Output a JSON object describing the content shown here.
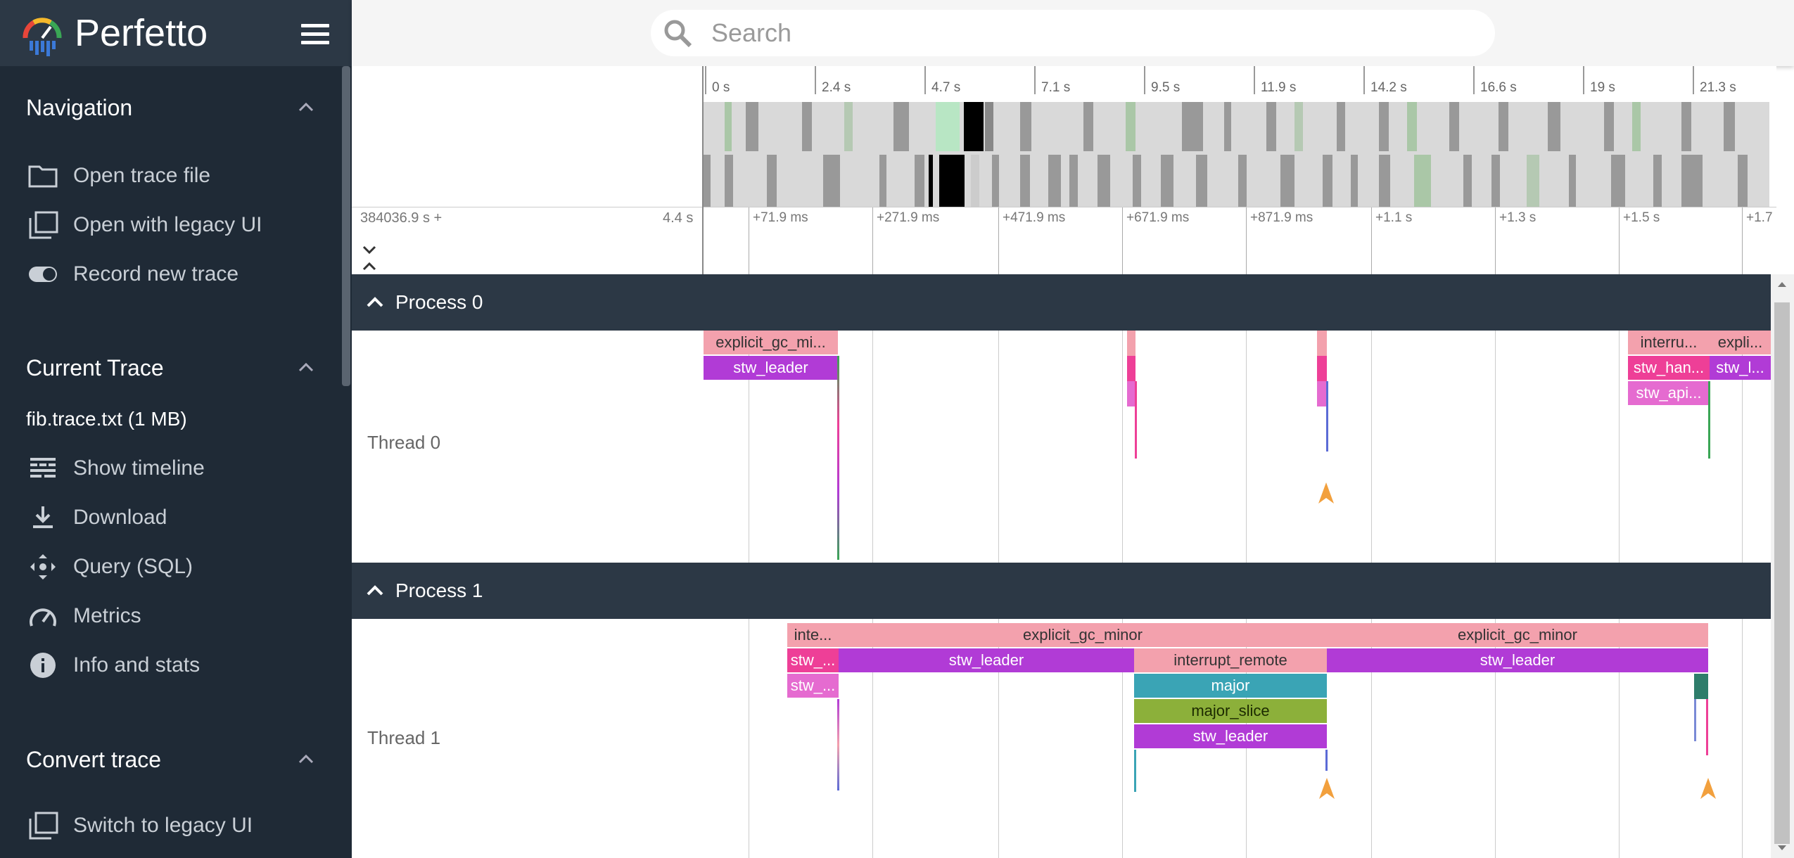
{
  "app": {
    "name": "Perfetto"
  },
  "sidebar": {
    "sections": [
      {
        "title": "Navigation",
        "items": [
          {
            "label": "Open trace file",
            "icon": "folder-icon"
          },
          {
            "label": "Open with legacy UI",
            "icon": "filter-none-icon"
          },
          {
            "label": "Record new trace",
            "icon": "toggle-icon"
          }
        ]
      },
      {
        "title": "Current Trace",
        "trace_name": "fib.trace.txt (1 MB)",
        "items": [
          {
            "label": "Show timeline",
            "icon": "timeline-icon"
          },
          {
            "label": "Download",
            "icon": "download-icon"
          },
          {
            "label": "Query (SQL)",
            "icon": "query-icon"
          },
          {
            "label": "Metrics",
            "icon": "speed-icon"
          },
          {
            "label": "Info and stats",
            "icon": "info-icon"
          }
        ]
      },
      {
        "title": "Convert trace",
        "items": [
          {
            "label": "Switch to legacy UI",
            "icon": "filter-none-icon"
          }
        ]
      }
    ]
  },
  "search": {
    "placeholder": "Search"
  },
  "overview": {
    "labels": [
      "0 s",
      "2.4 s",
      "4.7 s",
      "7.1 s",
      "9.5 s",
      "11.9 s",
      "14.2 s",
      "16.6 s",
      "19 s",
      "21.3 s"
    ]
  },
  "ruler": {
    "start": "384036.9 s +",
    "span": "4.4 s",
    "labels": [
      "+71.9 ms",
      "+271.9 ms",
      "+471.9 ms",
      "+671.9 ms",
      "+871.9 ms",
      "+1.1 s",
      "+1.3 s",
      "+1.5 s",
      "+1.7"
    ]
  },
  "processes": [
    {
      "name": "Process 0",
      "thread": "Thread 0",
      "slices": [
        "explicit_gc_mi...",
        "stw_leader",
        "interru...",
        "stw_han...",
        "stw_api...",
        "expli...",
        "stw_l..."
      ]
    },
    {
      "name": "Process 1",
      "thread": "Thread 1",
      "slices": [
        "inte...",
        "stw_...",
        "stw_...",
        "explicit_gc_minor",
        "stw_leader",
        "interrupt_remote",
        "major",
        "major_slice",
        "stw_leader",
        "explicit_gc_minor",
        "stw_leader"
      ]
    }
  ],
  "colors": {
    "sidebar_bg": "#1f2a36",
    "header_bg": "#2c3845",
    "accent_purple": "#b13bd6",
    "accent_pink": "#f3a1ad",
    "flow_arrow": "#f2a03d"
  }
}
